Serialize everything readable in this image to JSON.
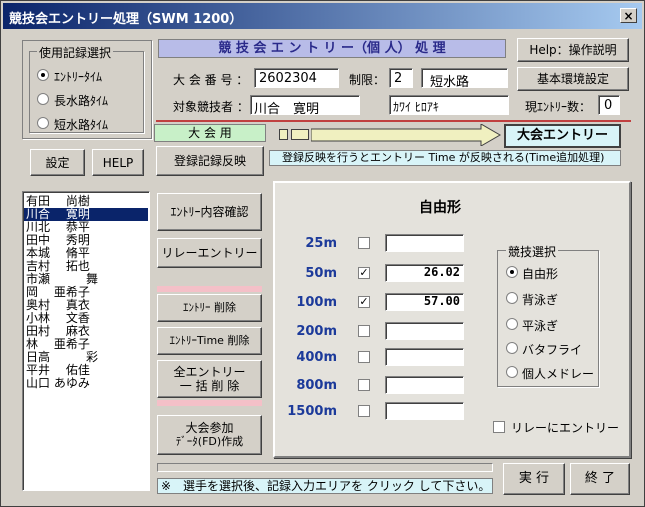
{
  "window": {
    "title": "競技会エントリー処理（SWM 1200）",
    "close": "×"
  },
  "record_select": {
    "legend": "使用記録選択",
    "options": [
      {
        "label": "ｴﾝﾄﾘｰﾀｲﾑ",
        "selected": true
      },
      {
        "label": "長水路ﾀｲﾑ",
        "selected": false
      },
      {
        "label": "短水路ﾀｲﾑ",
        "selected": false
      }
    ],
    "settings_button": "設定",
    "help_button": "HELP"
  },
  "header": {
    "title": "競 技 会 エ ン ト リ ー（個 人） 処 理",
    "help_button": "Help：操作説明",
    "env_button": "基本環境設定"
  },
  "meet": {
    "number_label": "大 会 番 号 ：",
    "number_value": "2602304",
    "limit_label": "制限：",
    "limit_value": "2",
    "course_value": "短水路",
    "athlete_label": "対象競技者 ：",
    "athlete_name": "川合　寛明",
    "athlete_kana": "ｶﾜｲ ﾋﾛｱｷ",
    "entry_count_label": "現ｴﾝﾄﾘｰ数：",
    "entry_count_value": "0"
  },
  "flow": {
    "meet_use_label": "大 会 用",
    "register_button": "登録記録反映",
    "meet_entry_label": "大会エントリー",
    "info_text": "登録反映を行うとエントリー Time が反映される(Time追加処理)"
  },
  "swimmers": [
    "有田　 尚樹",
    "川合　 寛明",
    "川北　 恭平",
    "田中　 秀明",
    "本城　 脩平",
    "吉村　 拓也",
    "市瀬　　　舞",
    "岡　 亜希子",
    "奥村　 真衣",
    "小林　 文香",
    "田村　 麻衣",
    "林　 亜希子",
    "日高　　　彩",
    "平井　 佑佳",
    "山口 あゆみ"
  ],
  "selected_swimmer_index": 1,
  "actions": {
    "confirm": "ｴﾝﾄﾘｰ内容確認",
    "relay": "リレーエントリー",
    "delete": "ｴﾝﾄﾘｰ 削除",
    "delete_time": "ｴﾝﾄﾘｰTime 削除",
    "delete_all_1": "全エントリー",
    "delete_all_2": "一 括 削 除",
    "create_1": "大会参加",
    "create_2": "ﾃﾞｰﾀ(FD)作成"
  },
  "events": {
    "stroke_title": "自由形",
    "distances": [
      {
        "label": "25m",
        "checked": false,
        "time": ""
      },
      {
        "label": "50m",
        "checked": true,
        "time": "26.02"
      },
      {
        "label": "100m",
        "checked": true,
        "time": "57.00"
      },
      {
        "label": "200m",
        "checked": false,
        "time": ""
      },
      {
        "label": "400m",
        "checked": false,
        "time": ""
      },
      {
        "label": "800m",
        "checked": false,
        "time": ""
      },
      {
        "label": "1500m",
        "checked": false,
        "time": ""
      }
    ],
    "check_mark": "✓",
    "stroke_select_legend": "競技選択",
    "strokes": [
      {
        "label": "自由形",
        "selected": true
      },
      {
        "label": "背泳ぎ",
        "selected": false
      },
      {
        "label": "平泳ぎ",
        "selected": false
      },
      {
        "label": "バタフライ",
        "selected": false
      },
      {
        "label": "個人メドレー",
        "selected": false
      }
    ],
    "relay_entry_label": "リレーにエントリー"
  },
  "footer": {
    "status": "※　選手を選択後、記録入力エリアを クリック して下さい。",
    "run_button": "実 行",
    "exit_button": "終 了"
  }
}
